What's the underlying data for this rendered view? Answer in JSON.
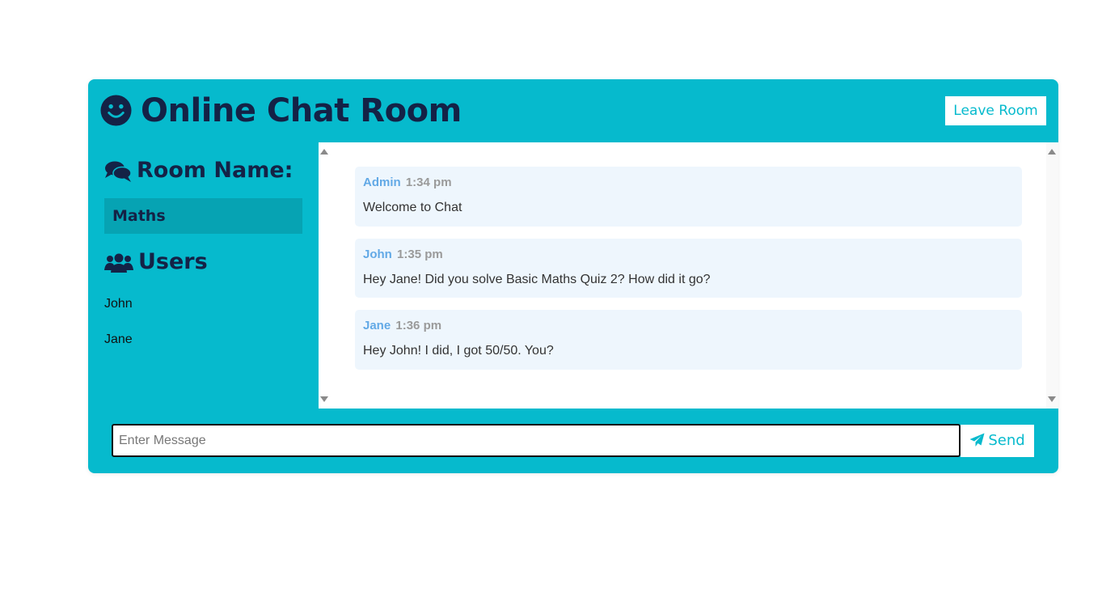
{
  "header": {
    "title": "Online Chat Room",
    "leave_label": "Leave Room",
    "logo_icon": "smile-icon"
  },
  "sidebar": {
    "room_heading": "Room Name:",
    "room_name": "Maths",
    "users_heading": "Users",
    "users": [
      "John",
      "Jane"
    ]
  },
  "messages": [
    {
      "author": "Admin",
      "time": "1:34 pm",
      "text": "Welcome to Chat"
    },
    {
      "author": "John",
      "time": "1:35 pm",
      "text": "Hey Jane! Did you solve Basic Maths Quiz 2? How did it go?"
    },
    {
      "author": "Jane",
      "time": "1:36 pm",
      "text": "Hey John! I did, I got 50/50. You?"
    }
  ],
  "composer": {
    "placeholder": "Enter Message",
    "value": "",
    "send_label": "Send"
  },
  "colors": {
    "accent": "#06bacd",
    "dark_text": "#142246",
    "room_name_bg": "#06a3b3",
    "message_bg": "#eef6fd",
    "author_color": "#62a9e6"
  }
}
